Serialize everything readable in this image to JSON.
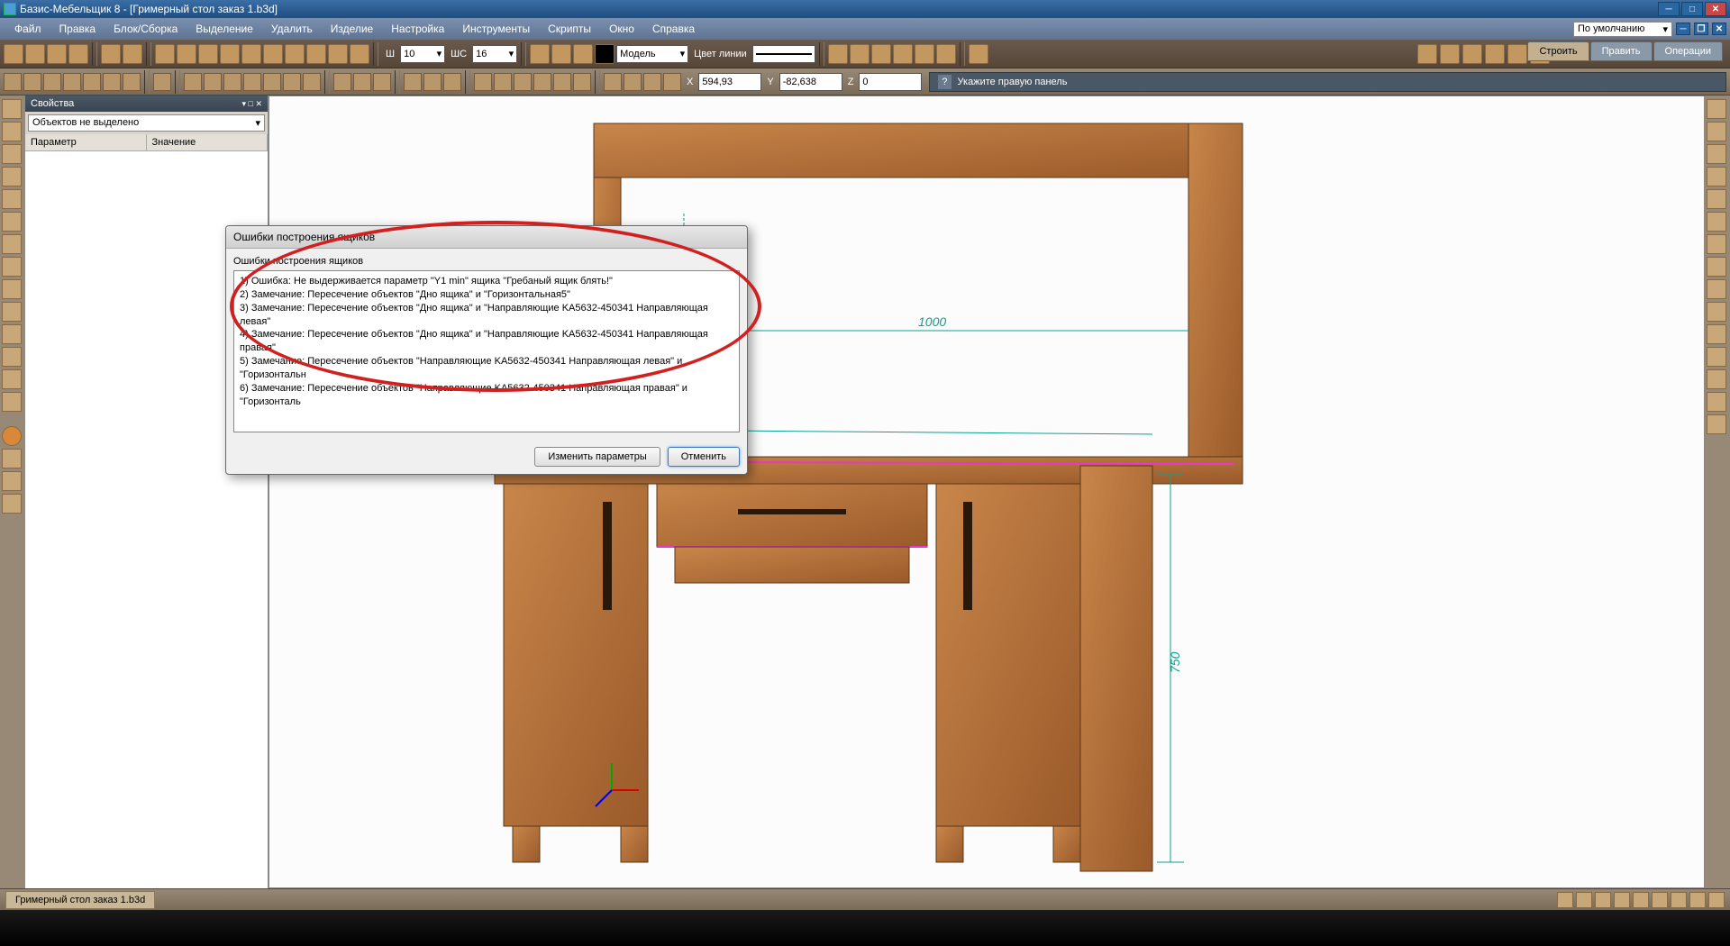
{
  "title": "Базис-Мебельщик 8 - [Гримерный стол заказ 1.b3d]",
  "menu": [
    "Файл",
    "Правка",
    "Блок/Сборка",
    "Выделение",
    "Удалить",
    "Изделие",
    "Настройка",
    "Инструменты",
    "Скрипты",
    "Окно",
    "Справка"
  ],
  "default_combo": "По умолчанию",
  "tb1": {
    "sh_lbl": "Ш",
    "sh_val": "10",
    "shs_lbl": "ШС",
    "shs_val": "16",
    "model": "Модель",
    "line_lbl": "Цвет линии"
  },
  "tabs_r": {
    "build": "Строить",
    "edit": "Править",
    "ops": "Операции"
  },
  "coords": {
    "x": "594,93",
    "y": "-82,638",
    "z": "0",
    "x_lbl": "X",
    "y_lbl": "Y",
    "z_lbl": "Z"
  },
  "hint": "Укажите правую панель",
  "prop": {
    "title": "Свойства",
    "combo": "Объектов не выделено",
    "c1": "Параметр",
    "c2": "Значение"
  },
  "dlg": {
    "title": "Ошибки построения ящиков",
    "group": "Ошибки построения ящиков",
    "lines": [
      "1) Ошибка: Не выдерживается параметр \"Y1 min\" ящика \"Гребаный ящик блять!\"",
      "2) Замечание: Пересечение объектов \"Дно ящика\" и \"Горизонтальная5\"",
      "3) Замечание: Пересечение объектов \"Дно ящика\" и \"Направляющие KA5632-450341 Направляющая левая\"",
      "4) Замечание: Пересечение объектов \"Дно ящика\" и \"Направляющие KA5632-450341 Направляющая правая\"",
      "5) Замечание: Пересечение объектов \"Направляющие KA5632-450341 Направляющая левая\" и \"Горизонтальн",
      "6) Замечание: Пересечение объектов \"Направляющие KA5632-450341 Направляющая правая\" и \"Горизонталь"
    ],
    "btn_change": "Изменить параметры",
    "btn_cancel": "Отменить"
  },
  "dims": {
    "w": "1000",
    "h": "750"
  },
  "status_tab": "Гримерный стол заказ 1.b3d"
}
